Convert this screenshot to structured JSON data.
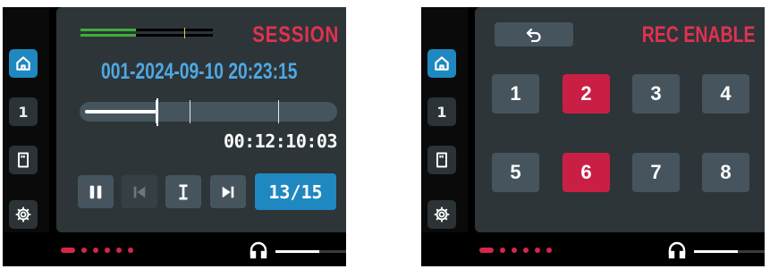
{
  "left_screen": {
    "sidebar": [
      {
        "icon": "home-icon",
        "label": "",
        "active": true
      },
      {
        "icon": "",
        "label": "1",
        "active": false
      },
      {
        "icon": "sd-card-icon",
        "label": "",
        "active": false
      },
      {
        "icon": "gear-icon",
        "label": "",
        "active": false
      }
    ],
    "title": "SESSION",
    "session_name": "001-2024-09-10 20:23:15",
    "meter_level": 0.42,
    "timeline_progress": 0.29,
    "timecode": "00:12:10:03",
    "transport": [
      {
        "icon": "pause-icon",
        "enabled": true
      },
      {
        "icon": "skip-back-icon",
        "enabled": false
      },
      {
        "icon": "marker-icon",
        "enabled": true
      },
      {
        "icon": "skip-forward-icon",
        "enabled": true
      }
    ],
    "marker_counter": "13/15"
  },
  "right_screen": {
    "sidebar": [
      {
        "icon": "home-icon",
        "label": "",
        "active": true
      },
      {
        "icon": "",
        "label": "1",
        "active": false
      },
      {
        "icon": "sd-card-icon",
        "label": "",
        "active": false
      },
      {
        "icon": "gear-icon",
        "label": "",
        "active": false
      }
    ],
    "back_icon": "back-arrow-icon",
    "title": "REC ENABLE",
    "tracks": [
      {
        "label": "1",
        "armed": false
      },
      {
        "label": "2",
        "armed": true
      },
      {
        "label": "3",
        "armed": false
      },
      {
        "label": "4",
        "armed": false
      },
      {
        "label": "5",
        "armed": false
      },
      {
        "label": "6",
        "armed": true
      },
      {
        "label": "7",
        "armed": false
      },
      {
        "label": "8",
        "armed": false
      }
    ]
  },
  "footer": {
    "page_dots": 6,
    "active_page": 1,
    "headphone_icon": "headphones-icon",
    "volume_level": 0.62
  },
  "colors": {
    "accent_blue": "#1f88c0",
    "accent_red": "#e23150",
    "armed_red": "#c91f45",
    "panel_bg": "#2d3538",
    "button_bg": "#46555d",
    "meter_green": "#3daf3d"
  }
}
